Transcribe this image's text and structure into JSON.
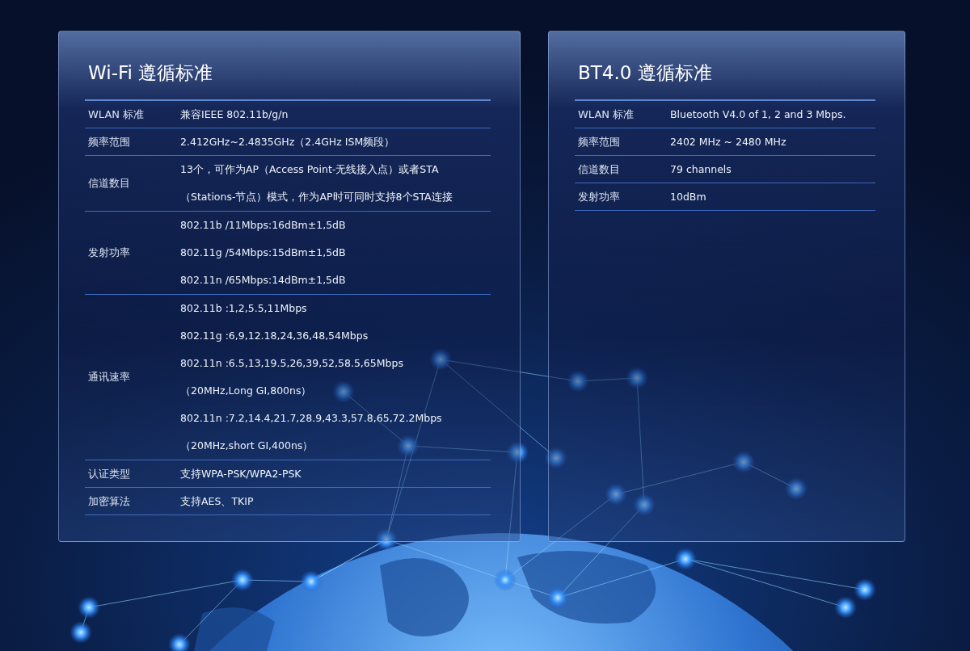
{
  "panels": [
    {
      "title": "Wi-Fi 遵循标准",
      "rows": [
        {
          "label": "WLAN 标准",
          "lines": [
            "兼容IEEE 802.11b/g/n"
          ]
        },
        {
          "label": "频率范围",
          "lines": [
            "2.412GHz~2.4835GHz（2.4GHz ISM频段）"
          ]
        },
        {
          "label": "信道数目",
          "lines": [
            "13个，可作为AP（Access Point-无线接入点）或者STA",
            "（Stations-节点）模式，作为AP时可同时支持8个STA连接"
          ]
        },
        {
          "label": "发射功率",
          "lines": [
            "802.11b /11Mbps:16dBm±1,5dB",
            "802.11g /54Mbps:15dBm±1,5dB",
            "802.11n /65Mbps:14dBm±1,5dB"
          ]
        },
        {
          "label": "通讯速率",
          "lines": [
            "802.11b :1,2,5.5,11Mbps",
            "802.11g :6,9,12.18,24,36,48,54Mbps",
            "802.11n :6.5,13,19.5,26,39,52,58.5,65Mbps",
            "（20MHz,Long GI,800ns）",
            "802.11n :7.2,14.4,21.7,28.9,43.3,57.8,65,72.2Mbps",
            "（20MHz,short GI,400ns）"
          ]
        },
        {
          "label": "认证类型",
          "lines": [
            "支持WPA-PSK/WPA2-PSK"
          ]
        },
        {
          "label": "加密算法",
          "lines": [
            "支持AES、TKIP"
          ]
        }
      ]
    },
    {
      "title": "BT4.0 遵循标准",
      "rows": [
        {
          "label": "WLAN 标准",
          "lines": [
            "Bluetooth V4.0 of 1, 2 and 3 Mbps."
          ]
        },
        {
          "label": "频率范围",
          "lines": [
            "2402 MHz ~ 2480 MHz"
          ]
        },
        {
          "label": "信道数目",
          "lines": [
            "79 channels"
          ]
        },
        {
          "label": "发射功率",
          "lines": [
            "10dBm"
          ]
        }
      ]
    }
  ]
}
